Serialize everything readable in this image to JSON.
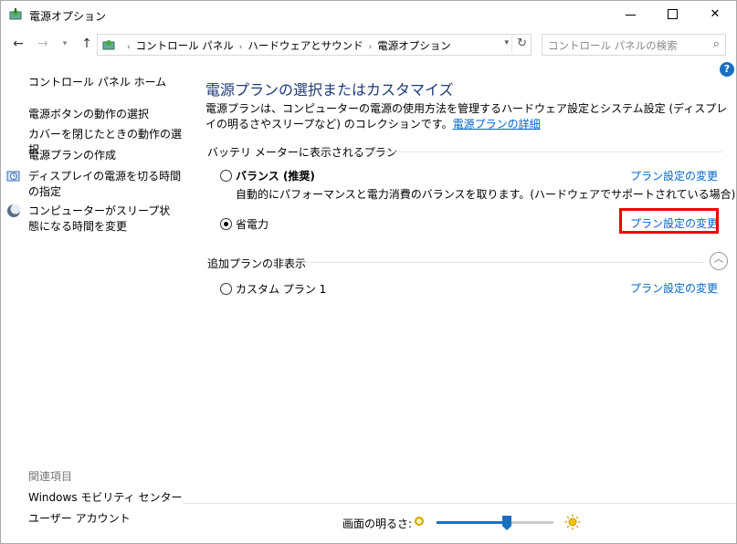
{
  "window": {
    "title": "電源オプション"
  },
  "address": {
    "crumbs": [
      "コントロール パネル",
      "ハードウェアとサウンド",
      "電源オプション"
    ],
    "search_placeholder": "コントロール パネルの検索"
  },
  "sidebar": {
    "home": "コントロール パネル ホーム",
    "items": [
      "電源ボタンの動作の選択",
      "カバーを閉じたときの動作の選択",
      "電源プランの作成",
      "ディスプレイの電源を切る時間の指定",
      "コンピューターがスリープ状態になる時間を変更"
    ],
    "related_header": "関連項目",
    "related": [
      "Windows モビリティ センター",
      "ユーザー アカウント"
    ]
  },
  "main": {
    "title": "電源プランの選択またはカスタマイズ",
    "desc": "電源プランは、コンピューターの電源の使用方法を管理するハードウェア設定とシステム設定 (ディスプレイの明るさやスリープなど) のコレクションです。",
    "desc_link": "電源プランの詳細",
    "battery_group": "バッテリ メーターに表示されるプラン",
    "hidden_group": "追加プランの非表示",
    "plans": [
      {
        "name": "バランス (推奨)",
        "desc": "自動的にパフォーマンスと電力消費のバランスを取ります。(ハードウェアでサポートされている場合)",
        "selected": false
      },
      {
        "name": "省電力",
        "selected": true
      },
      {
        "name": "カスタム プラン 1",
        "selected": false
      }
    ],
    "change_label": "プラン設定の変更"
  },
  "brightness": {
    "label": "画面の明るさ:",
    "level": 0.6
  },
  "colors": {
    "accent": "#1c6fbf",
    "title": "#1e3a78",
    "link": "#0066cc",
    "highlight": "#e00000"
  }
}
